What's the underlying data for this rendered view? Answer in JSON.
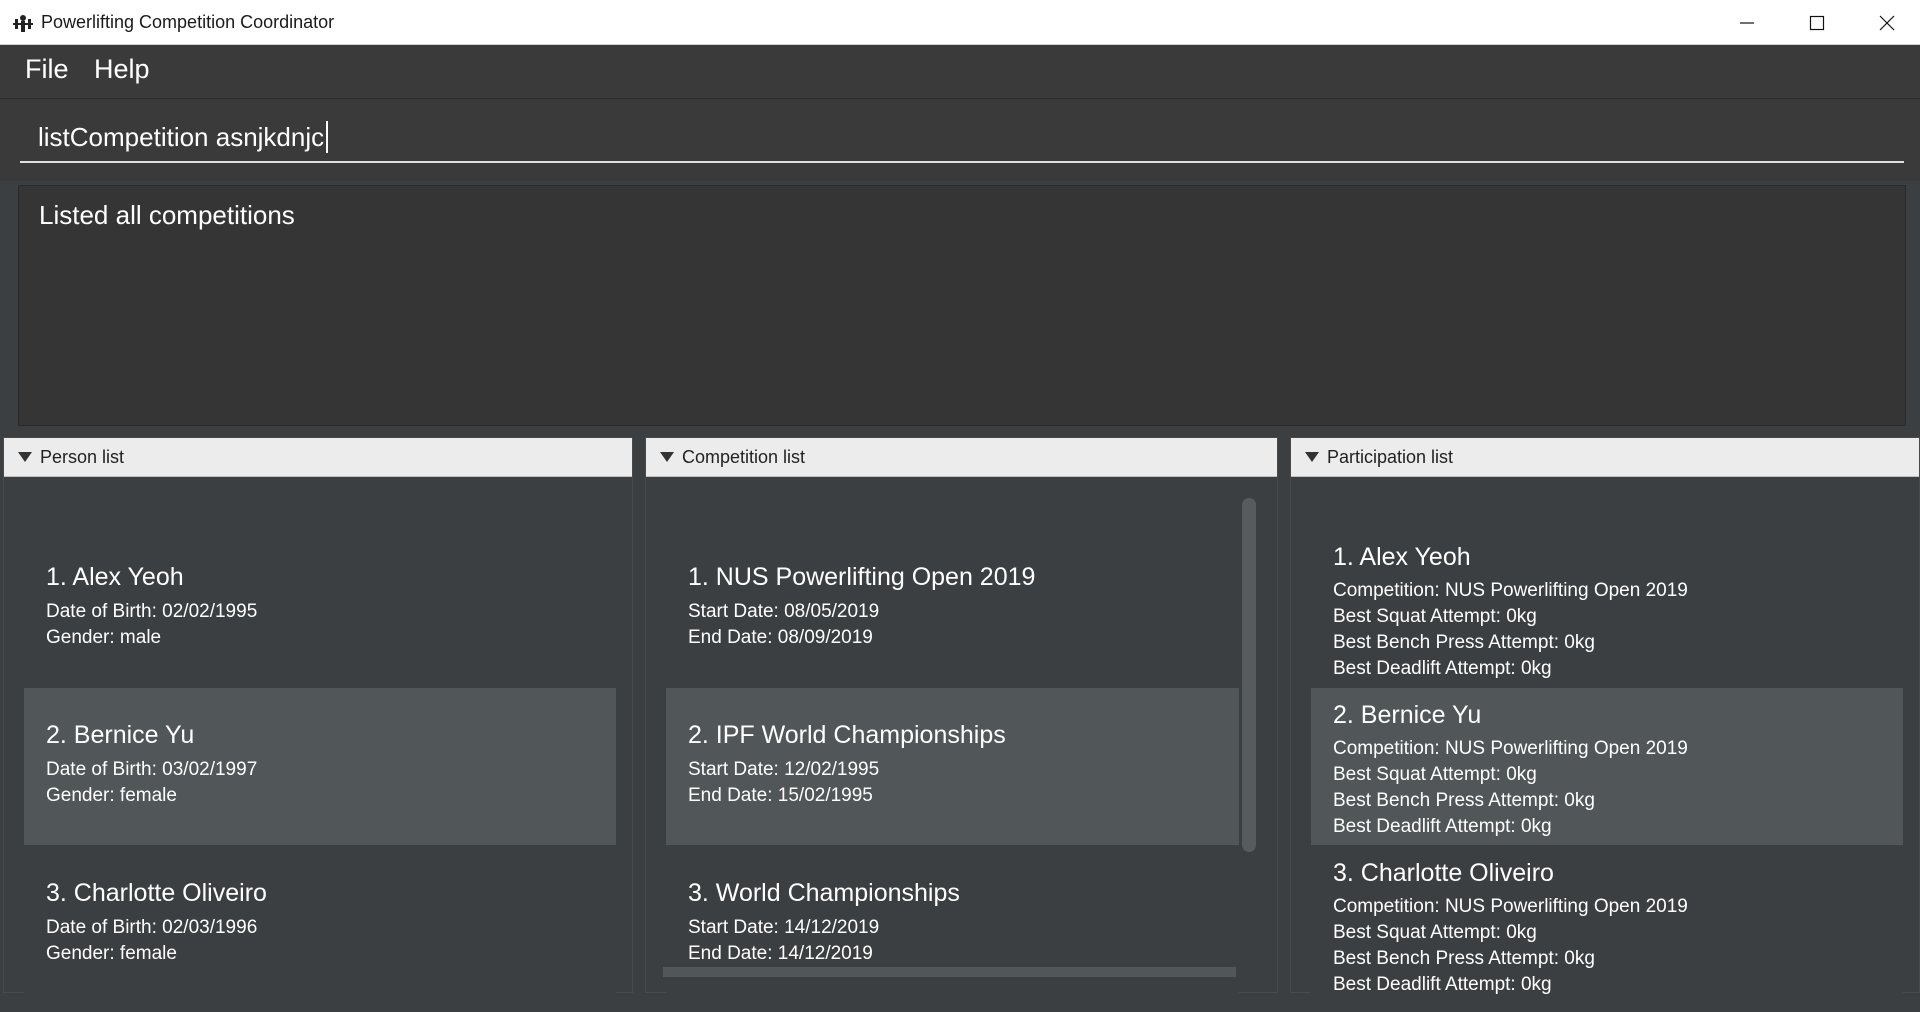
{
  "window": {
    "title": "Powerlifting Competition Coordinator"
  },
  "menu": {
    "file": "File",
    "help": "Help"
  },
  "command": {
    "value": "listCompetition asnjkdnjc"
  },
  "result": {
    "text": "Listed all competitions"
  },
  "person_panel": {
    "title": "Person list",
    "items": [
      {
        "name": "1.  Alex Yeoh",
        "dob": "Date of Birth: 02/02/1995",
        "gender": "Gender: male"
      },
      {
        "name": "2.  Bernice Yu",
        "dob": "Date of Birth: 03/02/1997",
        "gender": "Gender: female"
      },
      {
        "name": "3.  Charlotte Oliveiro",
        "dob": "Date of Birth: 02/03/1996",
        "gender": "Gender: female"
      }
    ]
  },
  "competition_panel": {
    "title": "Competition list",
    "items": [
      {
        "name": "1.  NUS Powerlifting Open 2019",
        "start": "Start Date: 08/05/2019",
        "end": "End Date: 08/09/2019"
      },
      {
        "name": "2.  IPF World Championships",
        "start": "Start Date: 12/02/1995",
        "end": "End Date: 15/02/1995"
      },
      {
        "name": "3.  World Championships",
        "start": "Start Date: 14/12/2019",
        "end": "End Date: 14/12/2019"
      }
    ]
  },
  "participation_panel": {
    "title": "Participation list",
    "items": [
      {
        "name": "1.  Alex Yeoh",
        "competition": "Competition: NUS Powerlifting Open 2019",
        "squat": "Best Squat Attempt: 0kg",
        "bench": "Best Bench Press Attempt: 0kg",
        "deadlift": "Best Deadlift Attempt: 0kg"
      },
      {
        "name": "2.  Bernice Yu",
        "competition": "Competition: NUS Powerlifting Open 2019",
        "squat": "Best Squat Attempt: 0kg",
        "bench": "Best Bench Press Attempt: 0kg",
        "deadlift": "Best Deadlift Attempt: 0kg"
      },
      {
        "name": "3.  Charlotte Oliveiro",
        "competition": "Competition: NUS Powerlifting Open 2019",
        "squat": "Best Squat Attempt: 0kg",
        "bench": "Best Bench Press Attempt: 0kg",
        "deadlift": "Best Deadlift Attempt: 0kg"
      }
    ]
  }
}
